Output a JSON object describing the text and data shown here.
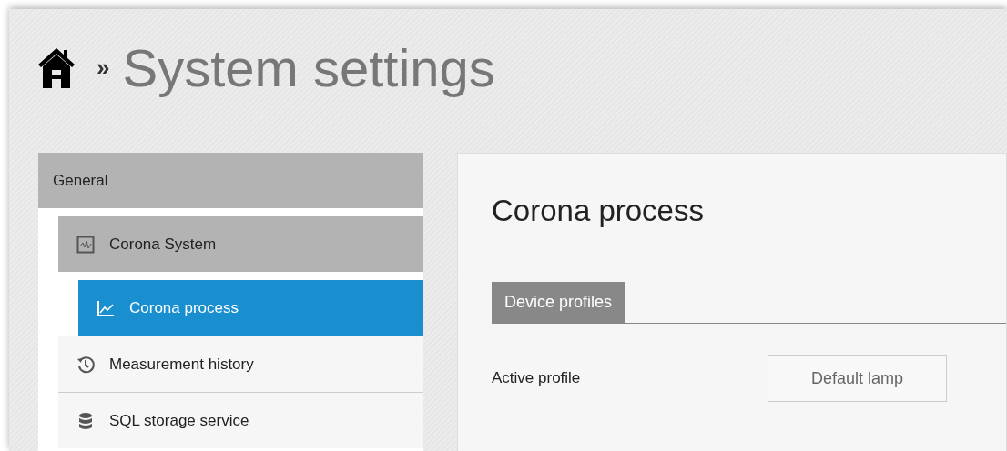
{
  "header": {
    "separator": "»",
    "title": "System settings"
  },
  "sidebar": {
    "group": "General",
    "items": [
      {
        "label": "Corona System",
        "selected": false,
        "expanded": true,
        "children": [
          {
            "label": "Corona process",
            "selected": true
          }
        ]
      },
      {
        "label": "Measurement history",
        "selected": false,
        "expanded": false
      },
      {
        "label": "SQL storage service",
        "selected": false,
        "expanded": false
      }
    ]
  },
  "content": {
    "title": "Corona process",
    "tabs": [
      {
        "label": "Device profiles",
        "selected": true
      }
    ],
    "fields": [
      {
        "label": "Active profile",
        "value": "Default lamp"
      }
    ]
  }
}
